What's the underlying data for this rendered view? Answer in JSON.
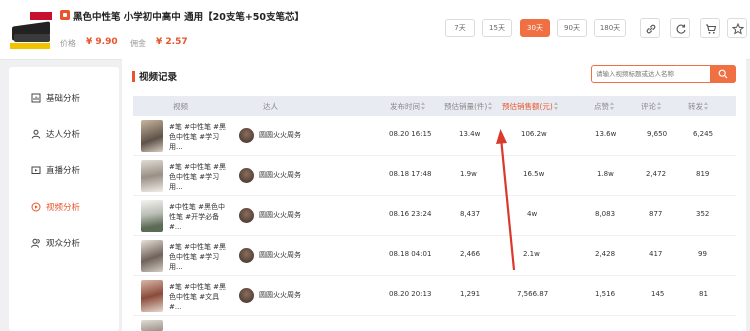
{
  "product": {
    "title": "黑色中性笔 小学初中高中 通用【20支笔+50支笔芯】",
    "price_label": "价格",
    "price_value": "¥ 9.90",
    "commission_label": "佣金",
    "commission_value": "¥ 2.57"
  },
  "ranges": [
    {
      "label": "7天",
      "active": false
    },
    {
      "label": "15天",
      "active": false
    },
    {
      "label": "30天",
      "active": true
    },
    {
      "label": "90天",
      "active": false
    },
    {
      "label": "180天",
      "active": false
    }
  ],
  "sidebar": {
    "items": [
      {
        "label": "基础分析",
        "icon": "chart-icon"
      },
      {
        "label": "达人分析",
        "icon": "user-icon"
      },
      {
        "label": "直播分析",
        "icon": "live-icon"
      },
      {
        "label": "视频分析",
        "icon": "video-icon",
        "active": true
      },
      {
        "label": "观众分析",
        "icon": "audience-icon"
      }
    ]
  },
  "main": {
    "section_title": "视频记录",
    "search_placeholder": "请输入视频标题或达人名称"
  },
  "table": {
    "headers": [
      "视频",
      "达人",
      "发布时间",
      "预估销量(件)",
      "预估销售额(元)",
      "点赞",
      "评论",
      "转发"
    ],
    "rows": [
      {
        "desc": "#笔 #中性笔 #黑色中性笔 #学习用...",
        "author": "圆圆火火周务",
        "time": "08.20 16:15",
        "sales": "13.4w",
        "revenue": "106.2w",
        "likes": "13.6w",
        "comments": "9,650",
        "shares": "6,245"
      },
      {
        "desc": "#笔 #中性笔 #黑色中性笔 #学习用...",
        "author": "圆圆火火周务",
        "time": "08.18 17:48",
        "sales": "1.9w",
        "revenue": "16.5w",
        "likes": "1.8w",
        "comments": "2,472",
        "shares": "819"
      },
      {
        "desc": "#中性笔 #黑色中性笔 #开学必备 #...",
        "author": "圆圆火火周务",
        "time": "08.16 23:24",
        "sales": "8,437",
        "revenue": "4w",
        "likes": "8,083",
        "comments": "877",
        "shares": "352"
      },
      {
        "desc": "#笔 #中性笔 #黑色中性笔 #学习用...",
        "author": "圆圆火火周务",
        "time": "08.18 04:01",
        "sales": "2,466",
        "revenue": "2.1w",
        "likes": "2,428",
        "comments": "417",
        "shares": "99"
      },
      {
        "desc": "#笔 #中性笔 #黑色中性笔 #文具 #...",
        "author": "圆圆火火周务",
        "time": "08.20 20:13",
        "sales": "1,291",
        "revenue": "7,566.87",
        "likes": "1,516",
        "comments": "145",
        "shares": "81"
      }
    ]
  },
  "colors": {
    "accent": "#e8552d"
  }
}
